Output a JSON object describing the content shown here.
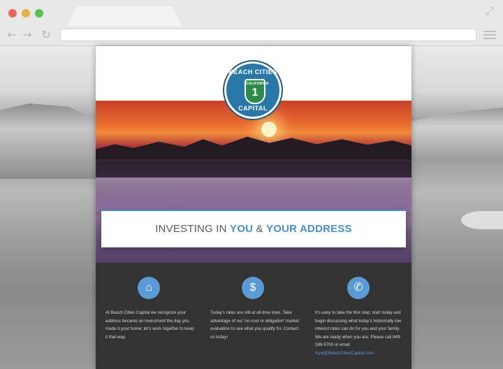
{
  "site": {
    "logo": {
      "top_text": "BEACH CITIES",
      "bottom_text": "CAPITAL",
      "shield_state": "CALIFORNIA",
      "shield_number": "1"
    },
    "tagline": {
      "part1": "INVESTING IN ",
      "highlight1": "YOU",
      "part2": " & ",
      "highlight2": "YOUR ADDRESS"
    },
    "columns": [
      {
        "icon": "home-icon",
        "text": "At Beach Cities Capital we recognize your address became an investment the day you made it your home; let's work together to keep it that way."
      },
      {
        "icon": "dollar-icon",
        "text": "Today's rates are still at all-time lows. Take advantage of our 'no-cost or obligation' market evaluation to see what you qualify for. Contact us today!"
      },
      {
        "icon": "phone-icon",
        "text_before": "It's easy to take the first step; start today and begin discussing what today's historically low interest rates can do for you and your family. We are ready when you are. Please call 949-289-5700 or email ",
        "email": "Kyle@BeachCitiesCapital.com"
      }
    ]
  },
  "colors": {
    "accent": "#4a90c8",
    "dark_section": "#333333",
    "icon_circle": "#5b9bd5"
  }
}
